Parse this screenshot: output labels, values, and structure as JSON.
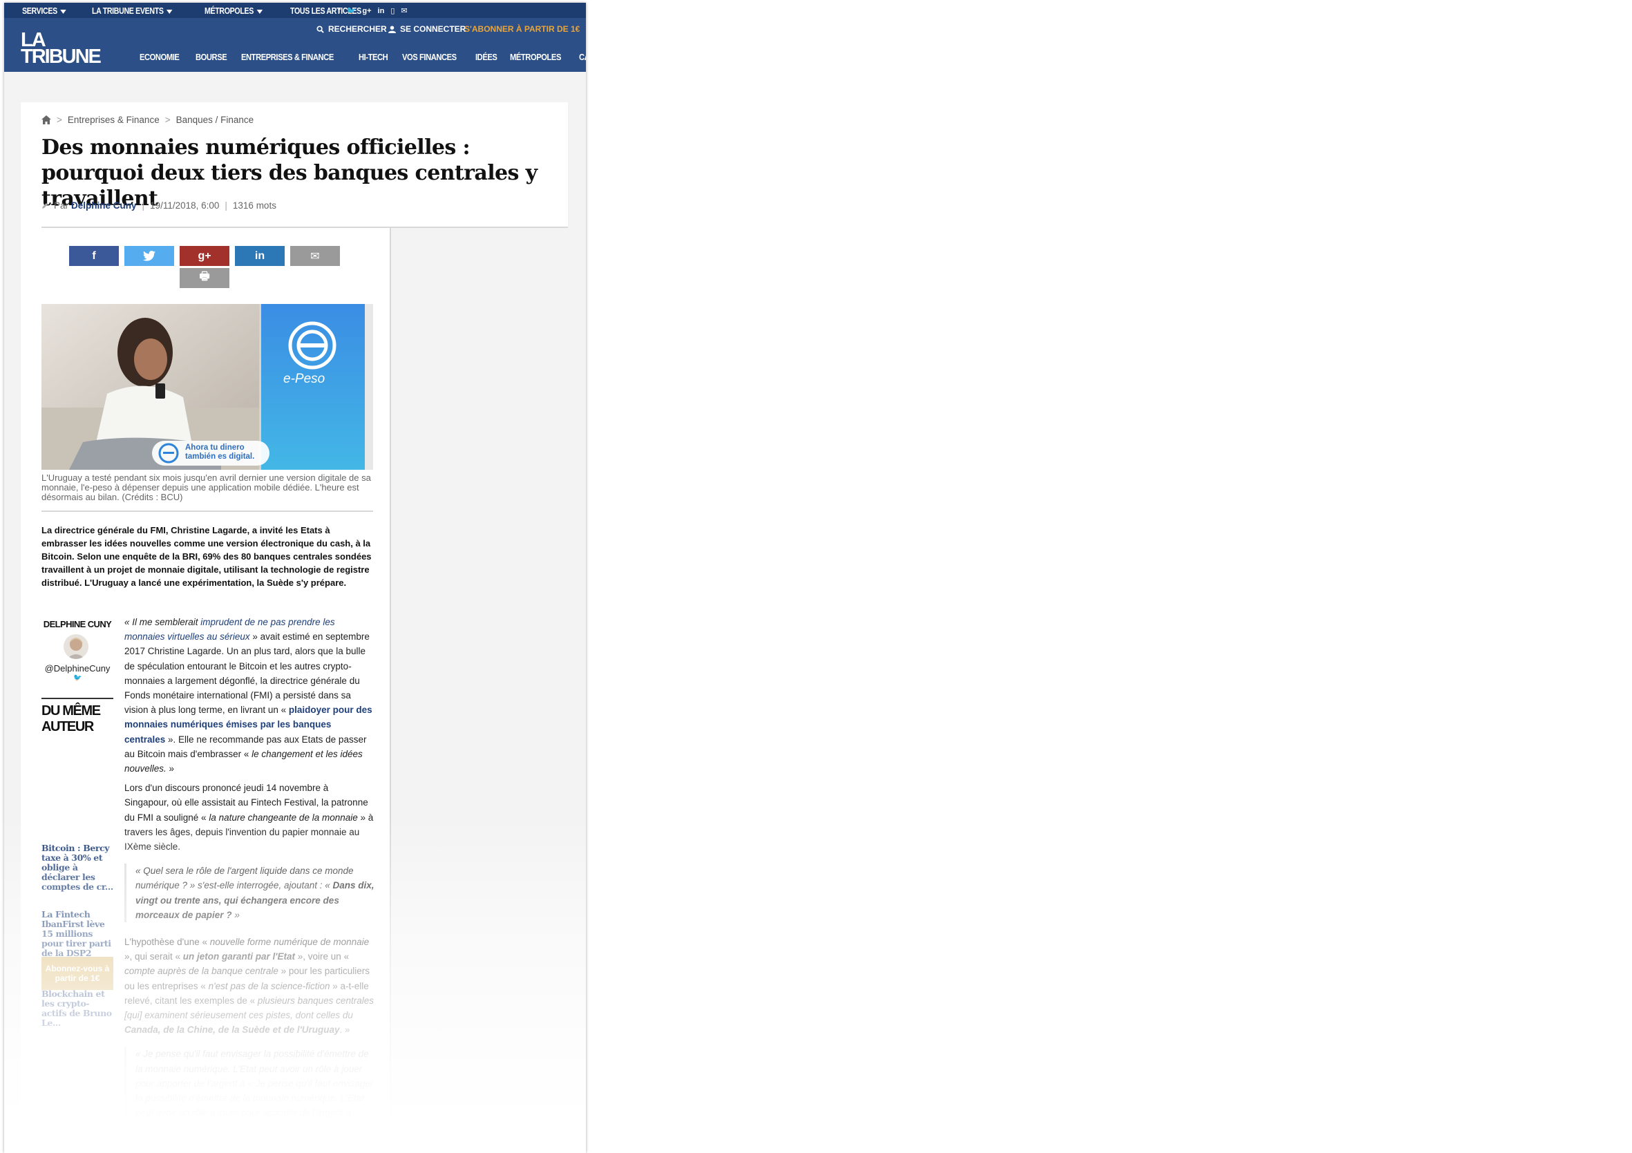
{
  "topbar": {
    "nav": [
      "SERVICES",
      "LA TRIBUNE EVENTS",
      "MÉTROPOLES",
      "TOUS LES ARTICLES"
    ],
    "social_icons": [
      "f",
      "🐦",
      "g+",
      "in",
      "▯",
      "✉"
    ],
    "search": "RECHERCHER",
    "login": "SE CONNECTER",
    "subscribe": "S'ABONNER À PARTIR DE 1€"
  },
  "logo": {
    "line1": "LA",
    "line2": "TRIBUNE"
  },
  "mainnav": [
    "ECONOMIE",
    "BOURSE",
    "ENTREPRISES & FINANCE",
    "HI-TECH",
    "VOS FINANCES",
    "IDÉES",
    "MÉTROPOLES",
    "CARRIÈRES"
  ],
  "breadcrumb": {
    "home_icon": "home-icon",
    "level1": "Entreprises & Finance",
    "level2": "Banques / Finance",
    "sep": ">"
  },
  "article": {
    "title": "Des monnaies numériques officielles : pourquoi deux tiers des banques centrales y travaillent",
    "by": "Par",
    "author": "Delphine Cuny",
    "date": "19/11/2018, 6:00",
    "words": "1316  mots",
    "image_brand": "e-Peso",
    "image_badge": "Ahora tu dinero también es digital.",
    "caption": "L'Uruguay a testé pendant six mois jusqu'en avril dernier une version digitale de sa monnaie, l'e-peso à dépenser depuis une application mobile dédiée. L'heure est désormais au bilan. (Crédits : BCU)",
    "chapo": "La directrice générale du FMI, Christine Lagarde, a invité les Etats à embrasser les idées nouvelles comme une version électronique du cash, à la Bitcoin. Selon une enquête de la BRI, 69% des 80 banques centrales sondées travaillent à un projet de monnaie digitale, utilisant la technologie de registre distribué. L'Uruguay a lancé une expérimentation, la Suède s'y prépare."
  },
  "share": {
    "facebook": "f",
    "twitter": "🐦",
    "gplus": "g+",
    "linkedin": "in",
    "email": "✉",
    "print": "🖶"
  },
  "sidebar": {
    "author_name": "DELPHINE CUNY",
    "handle": "@DelphineCuny",
    "twitter_glyph": "🐦",
    "du_meme_auteur": "DU MÊME AUTEUR",
    "related": [
      "Bitcoin : Bercy taxe à 30% et oblige à déclarer les comptes de cr...",
      "La Fintech IbanFirst lève 15 millions pour tirer parti de la DSP2",
      "Le plaidoyer pour la Blockchain et les crypto-actifs de Bruno Le..."
    ],
    "subscribe_btn": "Abonnez-vous à partir de 1€"
  },
  "body": {
    "p1_a": "« Il me semblerait ",
    "p1_link": "imprudent de ne pas prendre les monnaies virtuelles au sérieux",
    "p1_b": " » avait estimé en septembre 2017 Christine Lagarde. Un an plus tard, alors que la bulle de spéculation entourant le Bitcoin et les autres crypto-monnaies a largement dégonflé, la directrice générale du Fonds monétaire international (FMI) a persisté dans sa vision à plus long terme, en livrant un « ",
    "p1_link2": "plaidoyer pour des monnaies numériques émises par les banques centrales",
    "p1_c": " ». Elle ne recommande pas aux Etats de passer au Bitcoin mais d'embrasser « ",
    "p1_em": "le changement et les idées nouvelles.",
    "p1_d": " »",
    "p2_a": "Lors d'un discours prononcé jeudi 14 novembre à Singapour, où elle assistait au Fintech Festival, la patronne du FMI a souligné « ",
    "p2_em": "la nature changeante de la monnaie",
    "p2_b": " » à travers les âges, depuis l'invention du papier monnaie au IXème siècle.",
    "quote_a": "« Quel sera le rôle de l'argent liquide dans ce monde numérique ? » s'est-elle interrogée, ajoutant : « ",
    "quote_b": "Dans dix, vingt ou trente ans, qui échangera encore des morceaux de papier ?",
    "quote_c": " »",
    "p3_a": "L'hypothèse d'une « ",
    "p3_em1": "nouvelle forme numérique de monnaie",
    "p3_b": " », qui serait « ",
    "p3_strong1": "un jeton garanti par l'Etat",
    "p3_c": " », voire un « ",
    "p3_em2": "compte auprès de la banque centrale",
    "p3_d": " » pour les particuliers ou les entreprises « ",
    "p3_em3": "n'est pas de la science-fiction",
    "p3_e": " » a-t-elle relevé, citant les exemples de « ",
    "p3_em4": "plusieurs banques centrales [qui] examinent sérieusement ces pistes, dont celles du ",
    "p3_strong2": "Canada, de la Chine, de la Suède et de l'Uruguay",
    "p3_f": ". »",
    "quote2": "« Je pense qu'il faut envisager la possibilité d'émettre de la monnaie numérique. L'Etat peut avoir un rôle à jouer pour apporter de l'argent à « Je pense qu'il faut envisager la possibilité d'émettre de la monnaie numérique. L'Etat peut avoir un rôle à jouer pour apporter de l'argent à"
  },
  "colors": {
    "header": "#2b4f86",
    "topbar": "#1d3d70",
    "link": "#1e3f7a",
    "subscribe": "#e9a53a",
    "facebook": "#3b5998",
    "twitter": "#55acee",
    "gplus": "#a3312b",
    "linkedin": "#2c77b5",
    "mail": "#9a9a9a",
    "abonnez": "#d9b66a"
  }
}
